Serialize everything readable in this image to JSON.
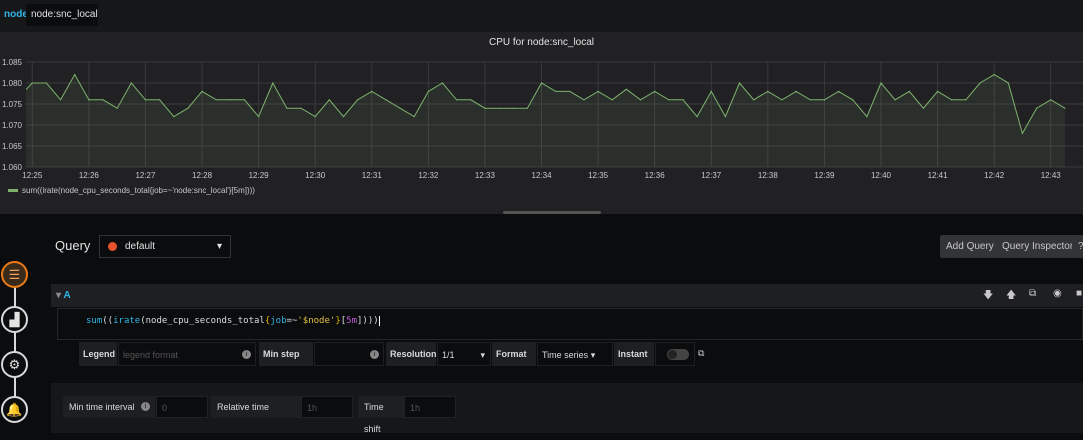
{
  "variable": {
    "label": "node",
    "value": "node:snc_local"
  },
  "panel": {
    "title": "CPU for node:snc_local",
    "legend": "sum((irate(node_cpu_seconds_total{job=~'node:snc_local'}[5m])))"
  },
  "chart_data": {
    "type": "area",
    "title": "CPU for node:snc_local",
    "x_ticks": [
      "12:25",
      "12:26",
      "12:27",
      "12:28",
      "12:29",
      "12:30",
      "12:31",
      "12:32",
      "12:33",
      "12:34",
      "12:35",
      "12:36",
      "12:37",
      "12:38",
      "12:39",
      "12:40",
      "12:41",
      "12:42",
      "12:43"
    ],
    "y_ticks": [
      "1.060",
      "1.065",
      "1.070",
      "1.075",
      "1.080",
      "1.085"
    ],
    "ylim": [
      1.06,
      1.085
    ],
    "grid": true,
    "legend_placement": "bottom-left",
    "series": [
      {
        "name": "sum((irate(node_cpu_seconds_total{job=~'node:snc_local'}[5m])))",
        "color": "#7eb26d",
        "x_start": "12:24:45",
        "x_step_seconds": 15,
        "values": [
          1.0765,
          1.08,
          1.08,
          1.076,
          1.082,
          1.076,
          1.076,
          1.074,
          1.08,
          1.076,
          1.076,
          1.072,
          1.074,
          1.078,
          1.076,
          1.076,
          1.076,
          1.072,
          1.08,
          1.074,
          1.074,
          1.072,
          1.076,
          1.072,
          1.076,
          1.078,
          1.076,
          1.074,
          1.072,
          1.078,
          1.08,
          1.076,
          1.076,
          1.074,
          1.074,
          1.074,
          1.074,
          1.08,
          1.078,
          1.078,
          1.076,
          1.078,
          1.076,
          1.0785,
          1.076,
          1.078,
          1.076,
          1.076,
          1.072,
          1.078,
          1.072,
          1.08,
          1.076,
          1.078,
          1.076,
          1.078,
          1.076,
          1.076,
          1.078,
          1.076,
          1.072,
          1.08,
          1.076,
          1.078,
          1.074,
          1.078,
          1.076,
          1.076,
          1.08,
          1.082,
          1.08,
          1.068,
          1.074,
          1.076,
          1.074
        ]
      }
    ]
  },
  "query": {
    "label": "Query",
    "datasource": "default",
    "add_query": "Add Query",
    "inspector": "Query Inspector",
    "help": "?"
  },
  "row": {
    "title": "A",
    "expr_parts": [
      "sum",
      "((",
      "irate",
      "(",
      "node_cpu_seconds_total",
      "{",
      "job",
      "=~",
      "'$node'",
      "}",
      "[",
      "5m",
      "]",
      ")))"
    ]
  },
  "options": {
    "legend_label": "Legend",
    "legend_placeholder": "legend format",
    "min_step_label": "Min step",
    "resolution_label": "Resolution",
    "resolution_value": "1/1",
    "format_label": "Format",
    "format_value": "Time series",
    "instant_label": "Instant",
    "instant_on": false
  },
  "options2": {
    "min_interval_label": "Min time interval",
    "min_interval_placeholder": "0",
    "relative_label": "Relative time",
    "relative_placeholder": "1h",
    "shift_label": "Time shift",
    "shift_placeholder": "1h"
  }
}
